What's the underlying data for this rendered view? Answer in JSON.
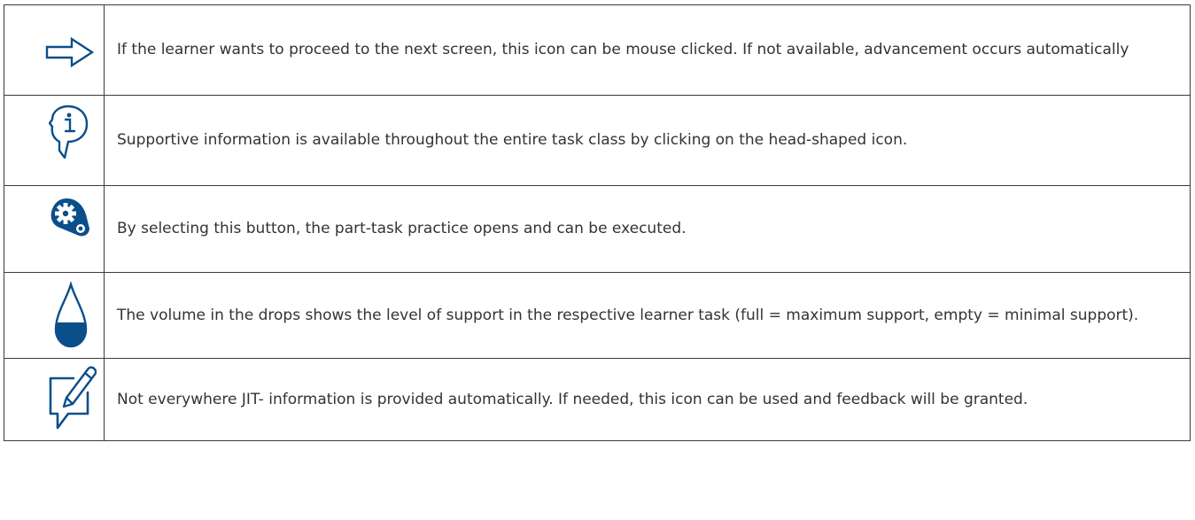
{
  "accent_color": "#0b4f8a",
  "rows": [
    {
      "icon": "arrow-right-icon",
      "text": "If the learner wants to proceed to the next screen, this icon can be mouse clicked. If not available, advancement occurs automatically"
    },
    {
      "icon": "head-info-icon",
      "text": "Supportive information is available throughout the entire task class by clicking on the head-shaped icon."
    },
    {
      "icon": "gear-practice-icon",
      "text": "By selecting this button, the part-task practice opens and can be executed."
    },
    {
      "icon": "drop-icon",
      "text": "The volume in the drops shows the level of support in the respective learner task (full = maximum support, empty = minimal support)."
    },
    {
      "icon": "feedback-pencil-icon",
      "text": "Not everywhere JIT- information is provided automatically. If needed, this icon can be used and feedback will be granted."
    }
  ]
}
